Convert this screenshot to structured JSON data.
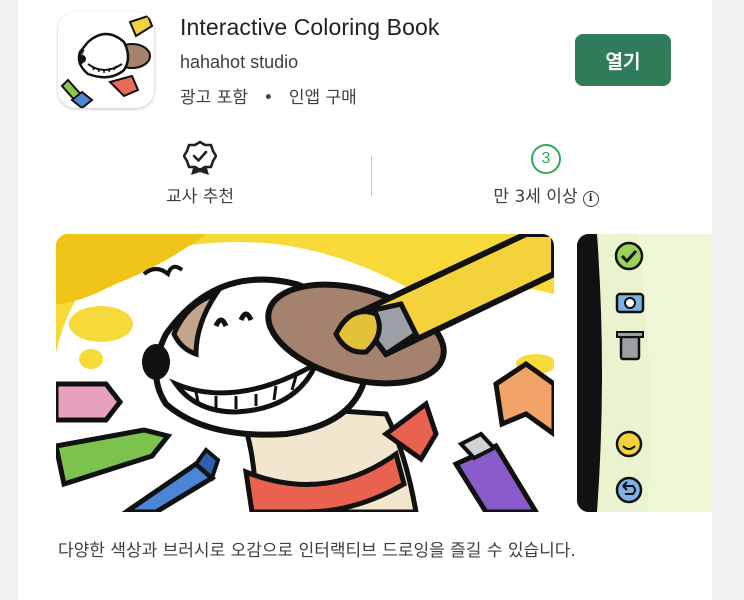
{
  "app": {
    "title": "Interactive Coloring Book",
    "developer": "hahahot studio",
    "meta_ads": "광고 포함",
    "meta_separator": "•",
    "meta_iap": "인앱 구매",
    "open_label": "열기",
    "accent_color": "#2f7d5a"
  },
  "info": {
    "teacher_label": "교사 추천",
    "teacher_icon": "badge-check-icon",
    "age_rating": "3",
    "age_label": "만 3세 이상",
    "info_icon_glyph": "i"
  },
  "screenshots": {
    "count_visible": 2
  },
  "description": "다양한 색상과 브러시로 오감으로 인터랙티브 드로잉을 즐길 수 있습니다."
}
